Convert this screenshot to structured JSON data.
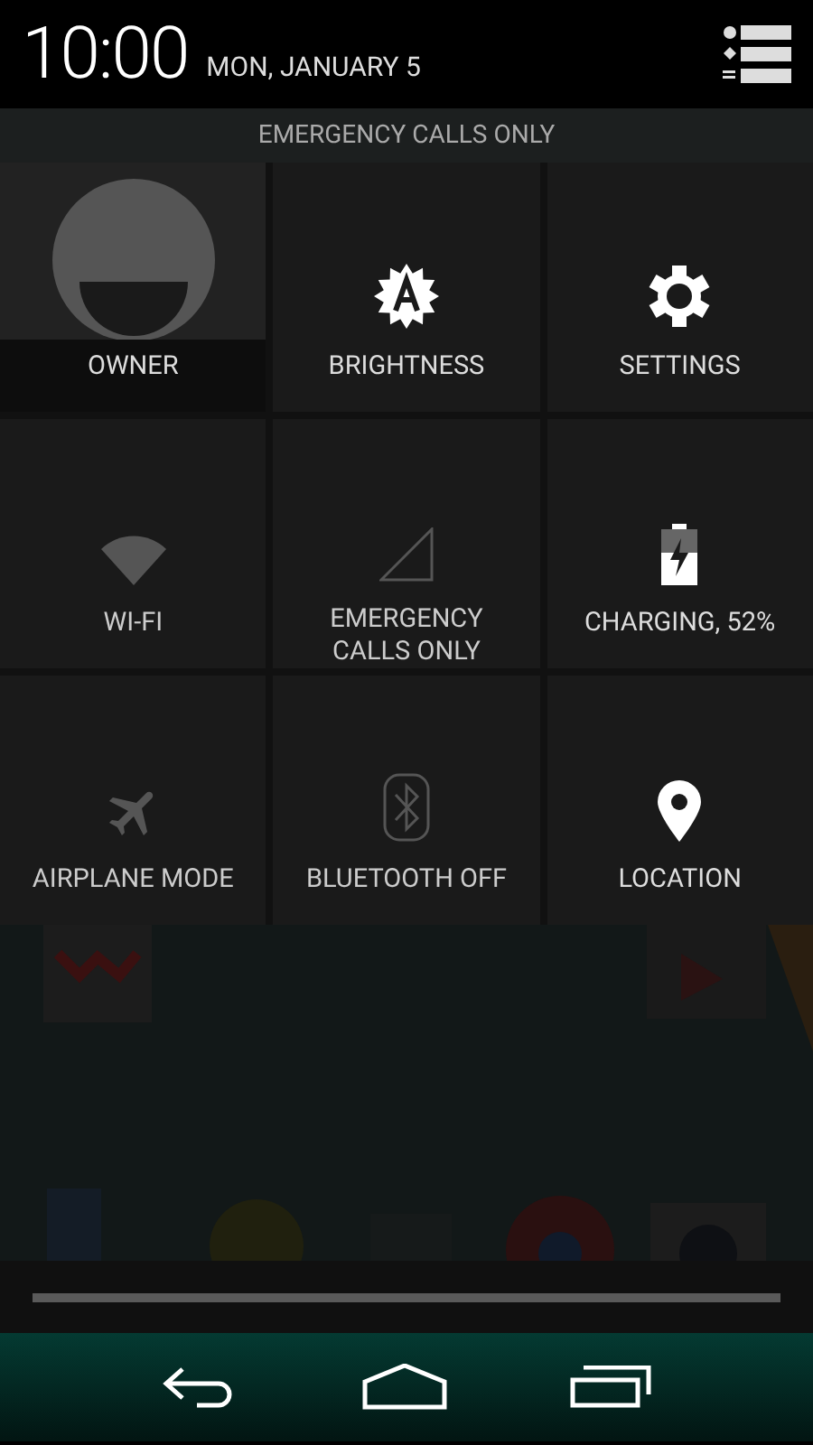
{
  "status_header": {
    "time": "10:00",
    "date": "MON, JANUARY 5"
  },
  "carrier_label": "EMERGENCY CALLS ONLY",
  "tiles": [
    {
      "kind": "user",
      "label": "OWNER",
      "active": true
    },
    {
      "kind": "brightness",
      "label": "BRIGHTNESS",
      "active": true
    },
    {
      "kind": "settings",
      "label": "SETTINGS",
      "active": true
    },
    {
      "kind": "wifi",
      "label": "WI-FI",
      "active": false
    },
    {
      "kind": "signal",
      "label": "EMERGENCY CALLS ONLY",
      "active": false
    },
    {
      "kind": "battery",
      "label": "CHARGING, 52%",
      "active": true
    },
    {
      "kind": "airplane",
      "label": "AIRPLANE MODE",
      "active": false
    },
    {
      "kind": "bluetooth",
      "label": "BLUETOOTH OFF",
      "active": false
    },
    {
      "kind": "location",
      "label": "LOCATION",
      "active": true
    }
  ]
}
